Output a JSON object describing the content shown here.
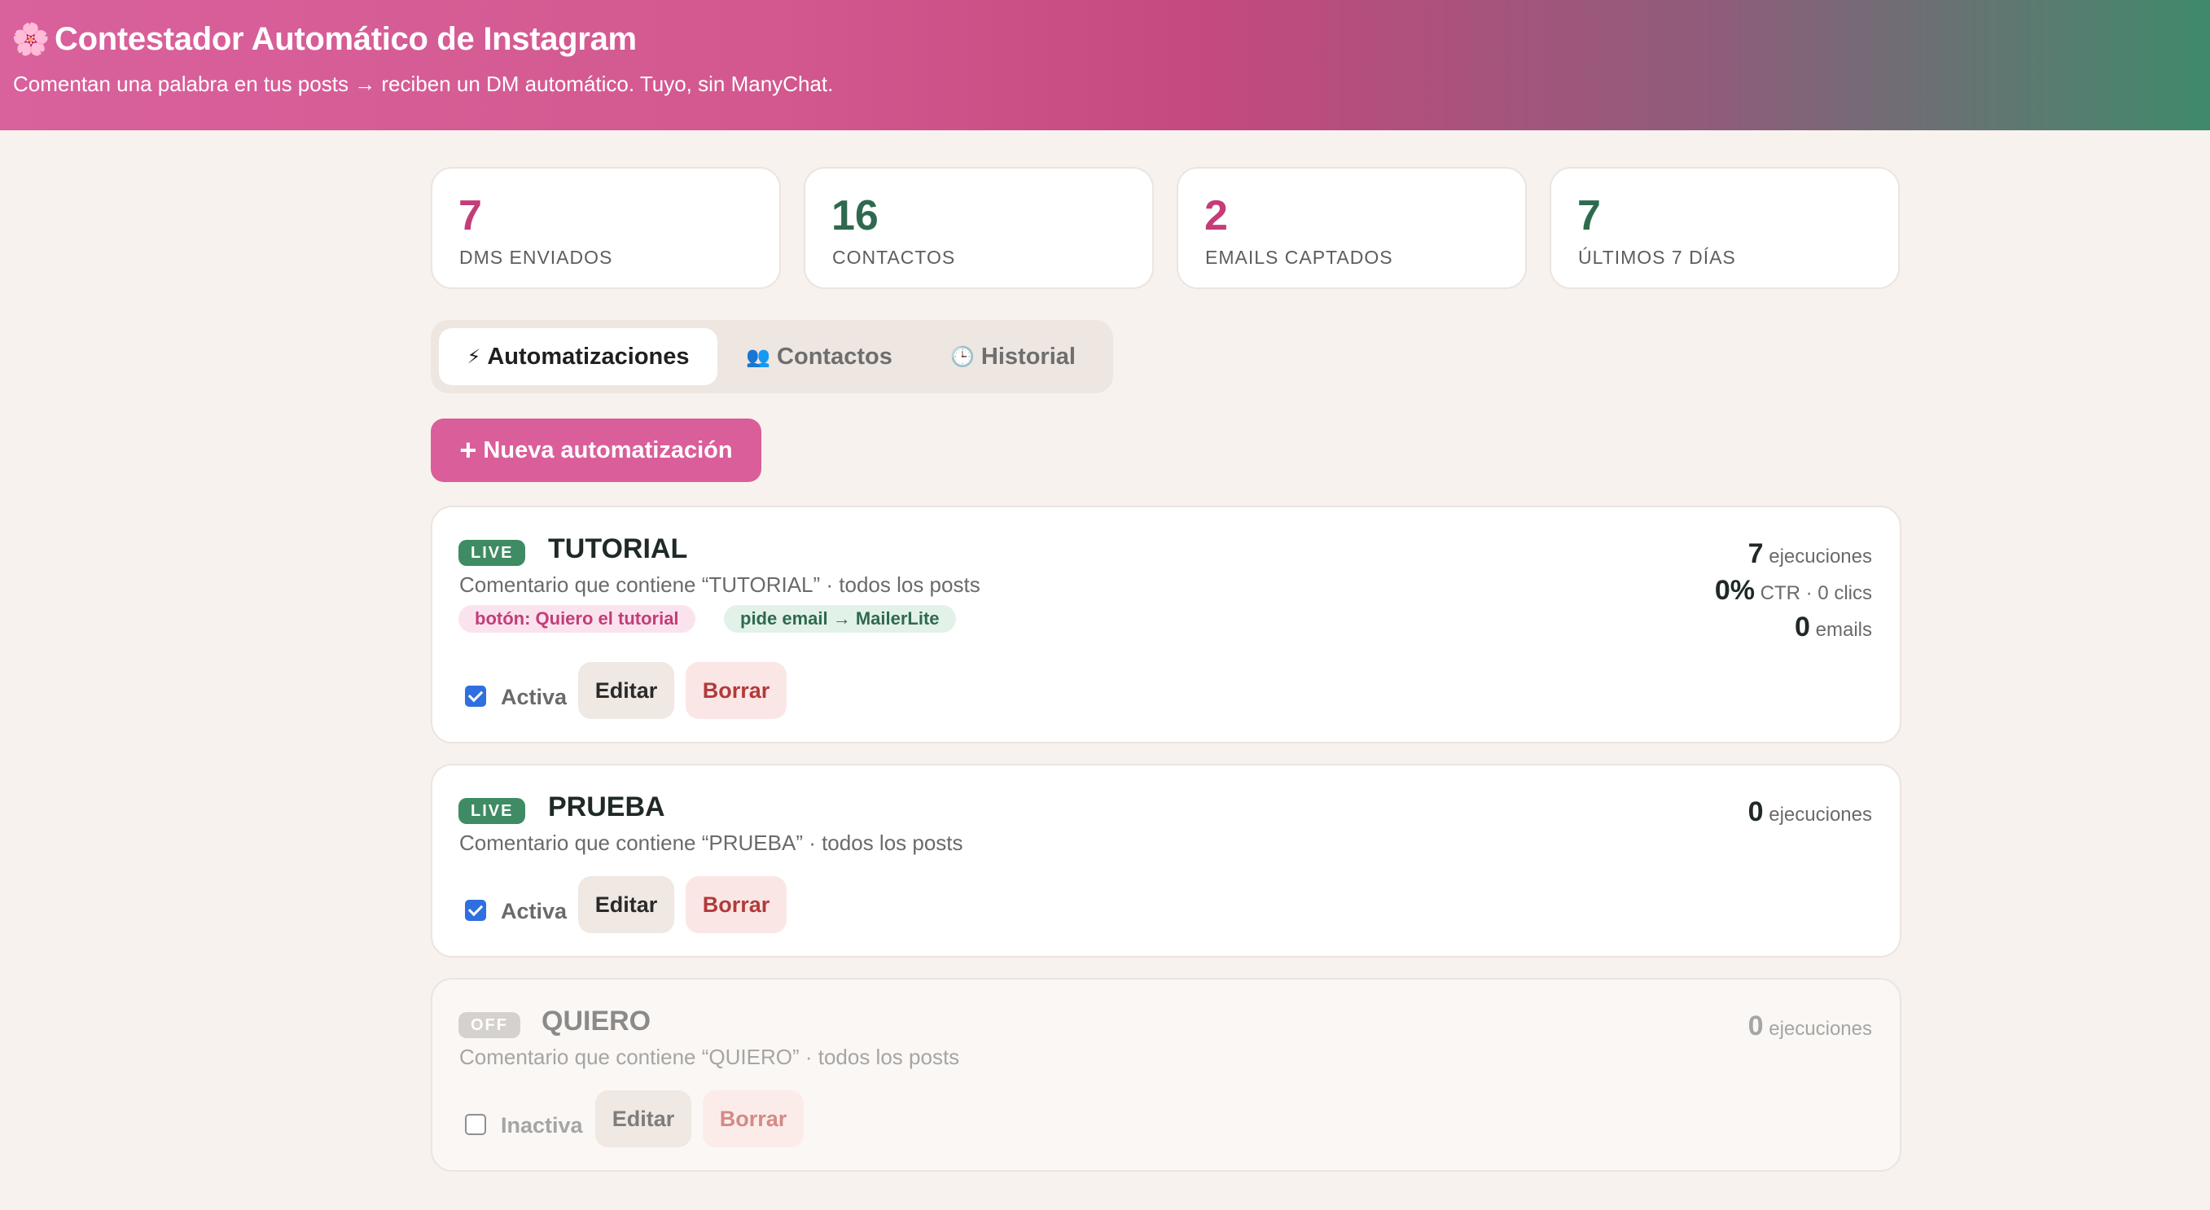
{
  "header": {
    "icon": "cherry-blossom-icon",
    "title": "Contestador Automático de Instagram",
    "subtitle": "Comentan una palabra en tus posts → reciben un DM automático. Tuyo, sin ManyChat."
  },
  "stats": [
    {
      "value": "7",
      "label": "DMS ENVIADOS",
      "color": "#c43c78"
    },
    {
      "value": "16",
      "label": "CONTACTOS",
      "color": "#2f6a4e"
    },
    {
      "value": "2",
      "label": "EMAILS CAPTADOS",
      "color": "#c43c78"
    },
    {
      "value": "7",
      "label": "ÚLTIMOS 7 DÍAS",
      "color": "#2f6a4e"
    }
  ],
  "tabs": [
    {
      "icon": "⚡",
      "label": "Automatizaciones",
      "active": true
    },
    {
      "icon": "👥",
      "label": "Contactos",
      "active": false
    },
    {
      "icon": "🕒",
      "label": "Historial",
      "active": false
    }
  ],
  "new_button": {
    "icon": "+",
    "label": "Nueva automatización"
  },
  "automations": [
    {
      "badge": "LIVE",
      "name": "TUTORIAL",
      "description": "Comentario que contiene “TUTORIAL” · todos los posts",
      "tags": [
        "botón: Quiero el tutorial",
        "pide email → MailerLite"
      ],
      "active_label": "Activa",
      "checked": true,
      "edit_label": "Editar",
      "delete_label": "Borrar",
      "executions_value": "7",
      "executions_label": "ejecuciones",
      "ctr_value": "0%",
      "ctr_label": "CTR · 0 clics",
      "emails_value": "0",
      "emails_label": "emails"
    },
    {
      "badge": "LIVE",
      "name": "PRUEBA",
      "description": "Comentario que contiene “PRUEBA” · todos los posts",
      "active_label": "Activa",
      "checked": true,
      "edit_label": "Editar",
      "delete_label": "Borrar",
      "executions_value": "0",
      "executions_label": "ejecuciones"
    },
    {
      "badge": "OFF",
      "name": "QUIERO",
      "description": "Comentario que contiene “QUIERO” · todos los posts",
      "active_label": "Inactiva",
      "checked": false,
      "edit_label": "Editar",
      "delete_label": "Borrar",
      "executions_value": "0",
      "executions_label": "ejecuciones"
    }
  ]
}
